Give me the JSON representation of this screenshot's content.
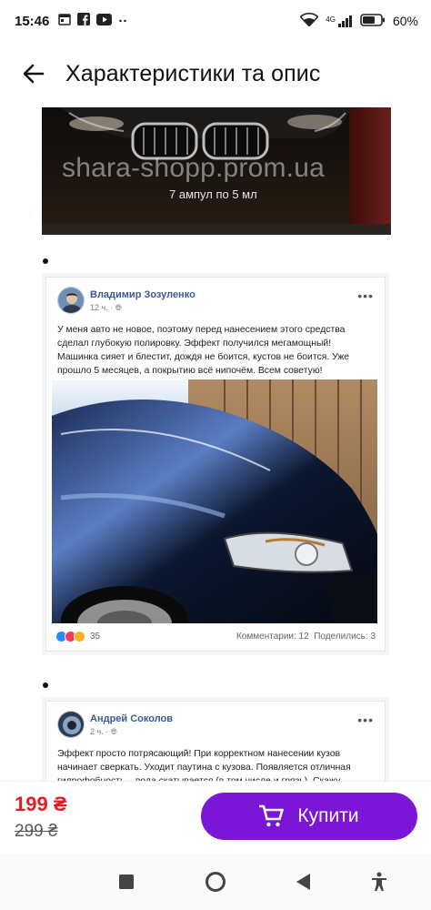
{
  "status_bar": {
    "time": "15:46",
    "network": "4G",
    "battery": "60%"
  },
  "header": {
    "title": "Характеристики та опис"
  },
  "product_image": {
    "watermark": "shara-shopp.prom.ua",
    "caption": "7 ампул по 5 мл"
  },
  "reviews": [
    {
      "author": "Владимир Зозуленко",
      "time": "12 ч.",
      "text": "У меня авто не новое, поэтому перед нанесением этого средства сделал глубокую полировку. Эффект получился мегамощный! Машинка сияет и блестит, дождя не боится, кустов не боится. Уже прошло 5 месяцев, а покрытию всё нипочём. Всем советую!",
      "reactions": "35",
      "stats": "Комментарии: 12  Поделились: 3"
    },
    {
      "author": "Андрей Соколов",
      "time": "2 ч.",
      "text": "Эффект просто потрясающий! При корректном нанесении кузов начинает сверкать. Уходит паутина с кузова. Появляется отличная гидрофобность – вода скатывается (в том числе и грязь). Скажу кратко:"
    }
  ],
  "buy_bar": {
    "price": "199 ₴",
    "old_price": "299 ₴",
    "buy_label": "Купити"
  },
  "colors": {
    "accent": "#7b16d6",
    "price": "#e31b23",
    "fb_author": "#385898"
  }
}
